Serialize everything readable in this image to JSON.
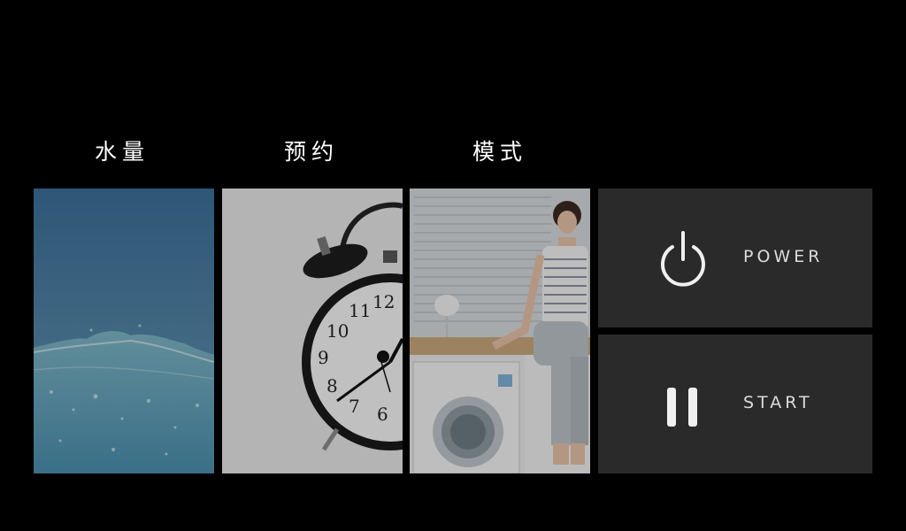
{
  "labels": {
    "water_level": "水量",
    "schedule": "预约",
    "mode": "模式"
  },
  "buttons": {
    "power": {
      "label": "POWER",
      "icon": "power-icon"
    },
    "start": {
      "label": "START",
      "icon": "pause-icon"
    }
  },
  "tiles": {
    "water": {
      "icon": "water-wave-image"
    },
    "clock": {
      "icon": "alarm-clock-image"
    },
    "mode": {
      "icon": "washing-machine-image"
    }
  },
  "colors": {
    "background": "#000000",
    "button_bg": "#2a2a2a",
    "text": "#ffffff"
  }
}
